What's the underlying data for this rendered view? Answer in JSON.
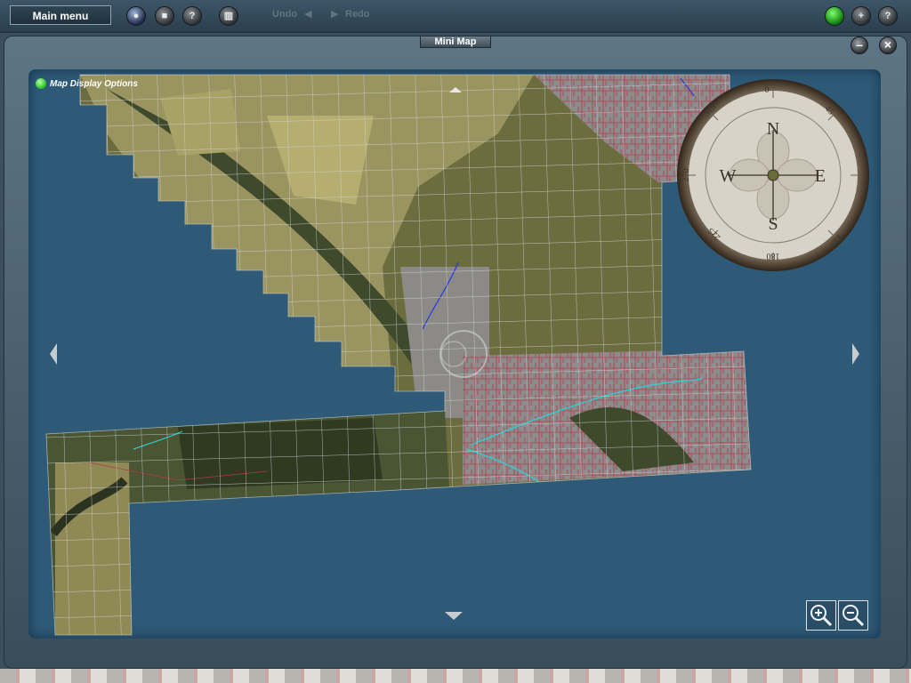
{
  "toolbar": {
    "main_menu_label": "Main menu",
    "undo_label": "Undo",
    "redo_label": "Redo",
    "buttons": [
      {
        "name": "play-icon",
        "glyph": "●"
      },
      {
        "name": "stop-icon",
        "glyph": "■"
      },
      {
        "name": "query-tool-icon",
        "glyph": "?"
      },
      {
        "name": "grid-icon",
        "glyph": "▥"
      }
    ],
    "right_buttons": [
      {
        "name": "status-light-icon",
        "glyph": ""
      },
      {
        "name": "add-icon",
        "glyph": "+"
      },
      {
        "name": "help-icon",
        "glyph": "?"
      }
    ]
  },
  "window": {
    "title": "Mini Map",
    "minimize_glyph": "–",
    "close_glyph": "×"
  },
  "map": {
    "display_options_label": "Map Display Options"
  },
  "compass": {
    "north": "N",
    "south": "S",
    "east": "E",
    "west": "W",
    "deg_0": "0",
    "deg_45": "45",
    "deg_135": "135",
    "deg_180": "180",
    "deg_225": "225",
    "deg_270": "270",
    "deg_315": "315"
  },
  "colors": {
    "water": "#2e5a78",
    "grid": "#cfd4d6",
    "terrain_dark": "#3f4a2c",
    "terrain_light": "#9a9560",
    "urban": "#8e8b8c",
    "road": "#b23a48",
    "river": "#2ad0d4"
  }
}
